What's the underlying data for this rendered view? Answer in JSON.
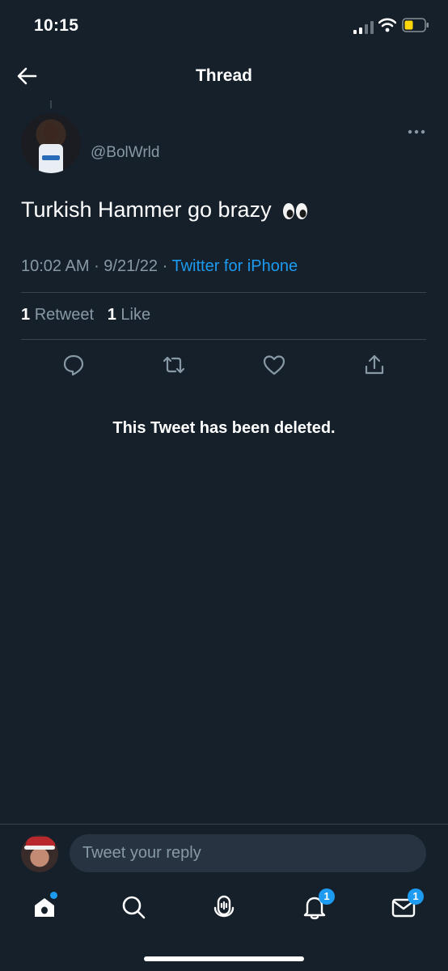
{
  "status_bar": {
    "time": "10:15",
    "signal_icon": "cellular-signal-icon",
    "wifi_icon": "wifi-icon",
    "battery_icon": "battery-icon",
    "battery_color": "#ffd60a"
  },
  "header": {
    "title": "Thread",
    "back_icon": "back-arrow-icon"
  },
  "tweet": {
    "handle": "@BolWrld",
    "text": "Turkish Hammer go brazy",
    "emoji_icon": "eyes-emoji-icon",
    "time": "10:02 AM",
    "date": "9/21/22",
    "source": "Twitter for iPhone",
    "retweet_count": "1",
    "retweet_label": "Retweet",
    "like_count": "1",
    "like_label": "Like",
    "more_icon": "more-options-icon"
  },
  "actions": [
    "reply-icon",
    "retweet-icon",
    "like-icon",
    "share-icon"
  ],
  "deleted_notice": "This Tweet has been deleted.",
  "reply": {
    "placeholder": "Tweet your reply"
  },
  "tab_bar": {
    "items": [
      {
        "icon": "home-icon",
        "badge": ""
      },
      {
        "icon": "search-icon",
        "badge": ""
      },
      {
        "icon": "spaces-icon",
        "badge": ""
      },
      {
        "icon": "notifications-icon",
        "badge": "1"
      },
      {
        "icon": "messages-icon",
        "badge": "1"
      }
    ]
  },
  "colors": {
    "background": "#15202b",
    "accent": "#1d9bf0",
    "muted": "#8899a6",
    "divider": "#38444d"
  }
}
